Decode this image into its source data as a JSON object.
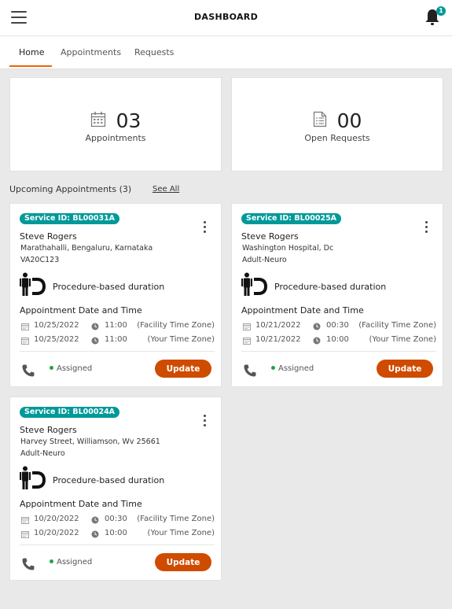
{
  "header": {
    "title": "DASHBOARD",
    "notification_count": "1"
  },
  "tabs": [
    {
      "label": "Home"
    },
    {
      "label": "Appointments"
    },
    {
      "label": "Requests"
    }
  ],
  "stats": {
    "appointments": {
      "value": "03",
      "label": "Appointments"
    },
    "requests": {
      "value": "00",
      "label": "Open Requests"
    }
  },
  "upcoming": {
    "title": "Upcoming Appointments (3)",
    "see_all": "See All"
  },
  "cards": [
    {
      "service_id": "Service ID: BL00031A",
      "name": "Steve Rogers",
      "address": "Marathahalli, Bengaluru, Karnataka",
      "sub": "VA20C123",
      "procedure": "Procedure-based duration",
      "appt_title": "Appointment Date and Time",
      "rows": [
        {
          "date": "10/25/2022",
          "time": "11:00",
          "tz": "(Facility Time Zone)"
        },
        {
          "date": "10/25/2022",
          "time": "11:00",
          "tz": "(Your Time Zone)"
        }
      ],
      "status": "Assigned",
      "button": "Update"
    },
    {
      "service_id": "Service ID: BL00025A",
      "name": "Steve Rogers",
      "address": "Washington Hospital, Dc",
      "sub": "Adult-Neuro",
      "procedure": "Procedure-based duration",
      "appt_title": "Appointment Date and Time",
      "rows": [
        {
          "date": "10/21/2022",
          "time": "00:30",
          "tz": "(Facility Time Zone)"
        },
        {
          "date": "10/21/2022",
          "time": "10:00",
          "tz": "(Your Time Zone)"
        }
      ],
      "status": "Assigned",
      "button": "Update"
    },
    {
      "service_id": "Service ID: BL00024A",
      "name": "Steve Rogers",
      "address": "Harvey Street, Williamson, Wv 25661",
      "sub": "Adult-Neuro",
      "procedure": "Procedure-based duration",
      "appt_title": "Appointment Date and Time",
      "rows": [
        {
          "date": "10/20/2022",
          "time": "00:30",
          "tz": "(Facility Time Zone)"
        },
        {
          "date": "10/20/2022",
          "time": "10:00",
          "tz": "(Your Time Zone)"
        }
      ],
      "status": "Assigned",
      "button": "Update"
    }
  ],
  "colors": {
    "accent": "#009999",
    "button": "#cf4b00",
    "tab_underline": "#ec6602",
    "status_dot": "#1ea34a"
  },
  "icons": [
    "menu-icon",
    "bell-icon",
    "calendar-icon",
    "document-icon",
    "procedure-icon",
    "clock-icon",
    "phone-icon",
    "more-vertical-icon"
  ]
}
